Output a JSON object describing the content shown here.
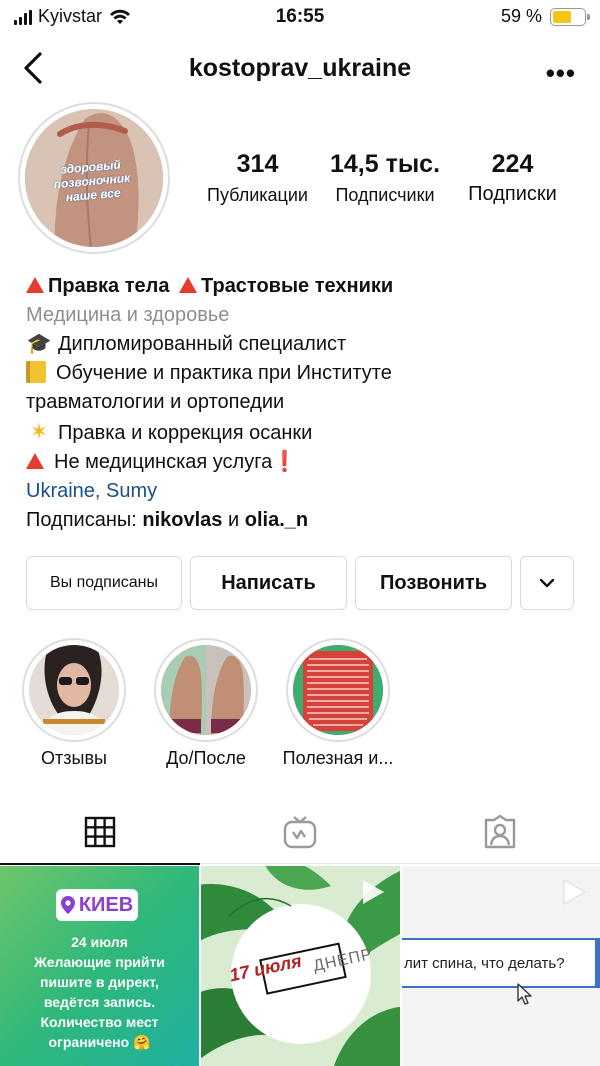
{
  "status_bar": {
    "carrier": "Kyivstar",
    "time": "16:55",
    "battery": "59 %",
    "battery_level": 0.59
  },
  "header": {
    "username": "kostoprav_ukraine",
    "back_icon": "chevron-left-icon",
    "more_icon": "more-horizontal-icon"
  },
  "profile": {
    "avatar_text": "здоровый позвоночник наше все",
    "stats": [
      {
        "value": "314",
        "label": "Публикации"
      },
      {
        "value": "14,5 тыс.",
        "label": "Подписчики"
      },
      {
        "value": "224",
        "label": "Подписки"
      }
    ]
  },
  "bio": {
    "name_part1": "Правка тела",
    "name_part2": "Трастовые техники",
    "category": "Медицина и здоровье",
    "lines": [
      {
        "icon": "graduation-cap-icon",
        "text": "Дипломированный специалист"
      },
      {
        "icon": "notebook-icon",
        "text": "Обучение и практика при Институте"
      },
      {
        "icon": "",
        "text": "травматологии и ортопедии"
      },
      {
        "icon": "sparkle-icon",
        "text": "Правка и коррекция осанки"
      },
      {
        "icon": "red-triangle-icon",
        "text": "Не медицинская услуга"
      }
    ],
    "location": "Ukraine, Sumy",
    "followed_by_prefix": "Подписаны: ",
    "followed_by_1": "nikovlas",
    "followed_by_and": " и ",
    "followed_by_2": "olia._n"
  },
  "actions": {
    "following": "Вы подписаны",
    "message": "Написать",
    "call": "Позвонить",
    "dropdown_icon": "chevron-down-icon"
  },
  "highlights": [
    {
      "label": "Отзывы"
    },
    {
      "label": "До/После"
    },
    {
      "label": "Полезная и..."
    }
  ],
  "tabs": {
    "active": "grid",
    "items": [
      "grid-icon",
      "igtv-icon",
      "tagged-icon"
    ]
  },
  "posts": {
    "post1": {
      "badge": "КИЕВ",
      "date": "24 июля",
      "lines": [
        "Желающие прийти",
        "пишите в директ,",
        "ведётся запись.",
        "Количество мест",
        "ограничено"
      ]
    },
    "post2": {
      "date": "17 июля",
      "city": "ДНЕПР"
    },
    "post3": {
      "caption": "лит спина, что делать?"
    }
  },
  "colors": {
    "accent_red": "#e43c2f",
    "location_blue": "#1b4f8a",
    "post1_green": "#2fbf71",
    "badge_purple": "#8a3fd1"
  }
}
